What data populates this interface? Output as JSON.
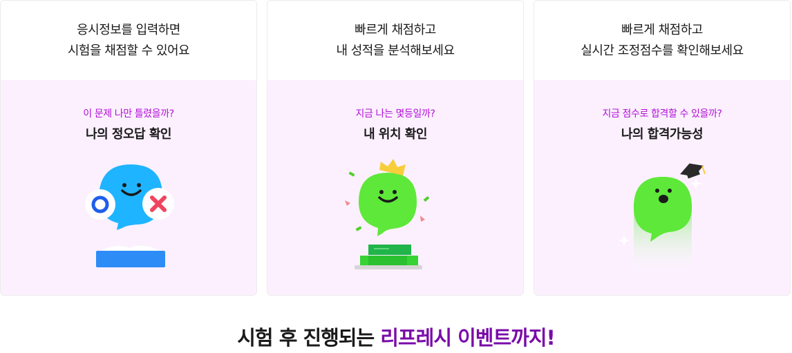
{
  "cards": [
    {
      "top_line1": "응시정보를 입력하면",
      "top_line2": "시험을 채점할 수 있어요",
      "question": "이 문제 나만 틀렸을까?",
      "title": "나의 정오답 확인"
    },
    {
      "top_line1": "빠르게 채점하고",
      "top_line2": "내 성적을 분석해보세요",
      "question": "지금 나는 몇등일까?",
      "title": "내 위치 확인"
    },
    {
      "top_line1": "빠르게 채점하고",
      "top_line2": "실시간 조정점수를 확인해보세요",
      "question": "지금 점수로 합격할 수 있을까?",
      "title": "나의 합격가능성"
    }
  ],
  "footer": {
    "part1": "시험 후 진행되는",
    "part2": "리프레시 이벤트까지!"
  },
  "colors": {
    "accent_purple": "#b10fd6",
    "footer_purple": "#7a0aa8",
    "card_bg": "#fcf0ff",
    "mascot_blue": "#1fb4ff",
    "mascot_green": "#5ee83a"
  }
}
